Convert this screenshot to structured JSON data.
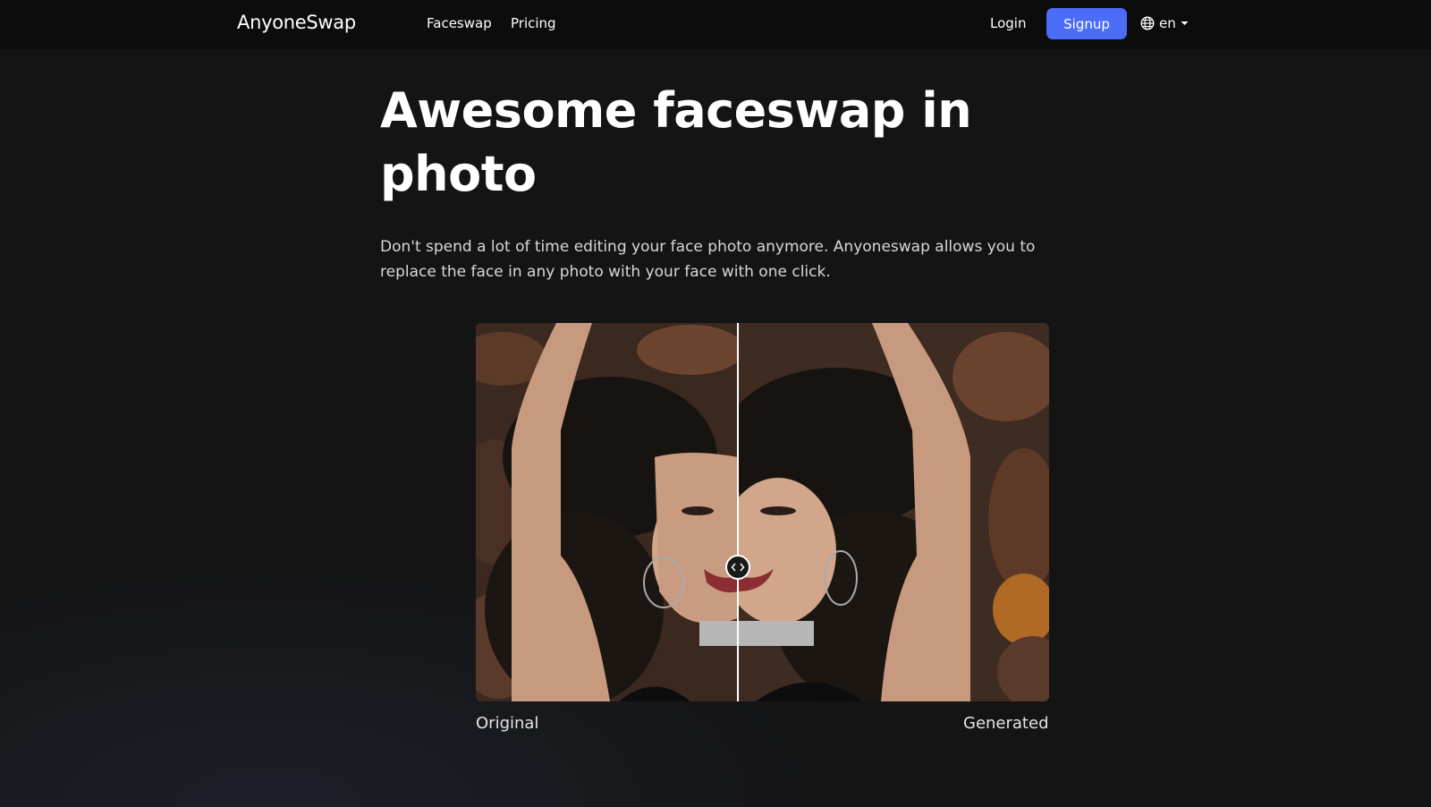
{
  "nav": {
    "logo": "AnyoneSwap",
    "links": [
      "Faceswap",
      "Pricing"
    ],
    "login": "Login",
    "signup": "Signup",
    "language": "en",
    "language_icon": "globe-icon",
    "accent": "#4a6cf7"
  },
  "hero": {
    "title": "Awesome faceswap in photo",
    "description": "Don't spend a lot of time editing your face photo anymore. Anyoneswap allows you to replace the face in any photo with your face with one click."
  },
  "comparison": {
    "left_caption": "Original",
    "right_caption": "Generated",
    "handle_icon": "chevron-left-right-icon",
    "slider_position": 0.457
  }
}
